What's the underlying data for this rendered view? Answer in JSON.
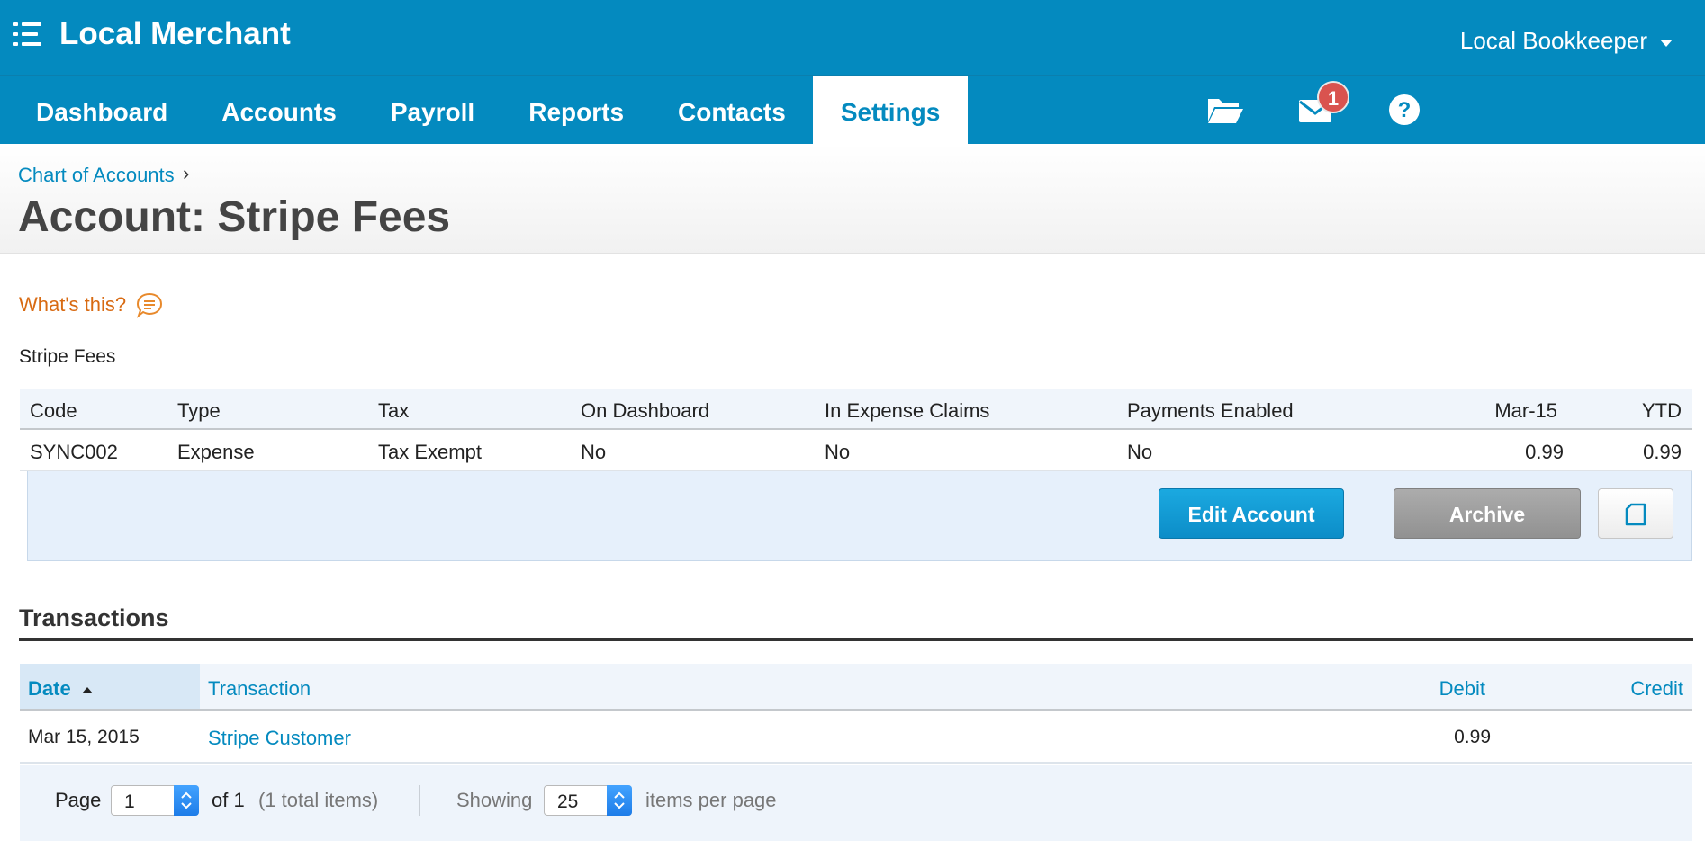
{
  "header": {
    "org_name": "Local Merchant",
    "user_name": "Local Bookkeeper",
    "brand_color": "#048abf",
    "icons": [
      "menu-icon",
      "folder-icon",
      "mail-icon",
      "help-icon"
    ]
  },
  "nav": {
    "items": [
      "Dashboard",
      "Accounts",
      "Payroll",
      "Reports",
      "Contacts",
      "Settings"
    ],
    "active": "Settings",
    "mail_badge": "1"
  },
  "breadcrumb": {
    "parent": "Chart of Accounts",
    "separator": "›"
  },
  "page_title": "Account: Stripe Fees",
  "whats_this": "What's this?",
  "account": {
    "name": "Stripe Fees",
    "columns": [
      "Code",
      "Type",
      "Tax",
      "On Dashboard",
      "In Expense Claims",
      "Payments Enabled",
      "Mar-15",
      "YTD"
    ],
    "values": [
      "SYNC002",
      "Expense",
      "Tax Exempt",
      "No",
      "No",
      "No",
      "0.99",
      "0.99"
    ]
  },
  "actions": {
    "edit_label": "Edit Account",
    "archive_label": "Archive"
  },
  "transactions": {
    "heading": "Transactions",
    "columns": {
      "date": "Date",
      "transaction": "Transaction",
      "debit": "Debit",
      "credit": "Credit"
    },
    "sort_column": "Date",
    "sort_direction": "ascending",
    "rows": [
      {
        "date": "Mar 15, 2015",
        "transaction": "Stripe Customer",
        "debit": "0.99",
        "credit": ""
      }
    ]
  },
  "pager": {
    "page_label": "Page",
    "page_value": "1",
    "of_label": "of 1",
    "total_label": "(1 total items)",
    "showing_label": "Showing",
    "per_page_value": "25",
    "per_page_label": "items per page"
  }
}
